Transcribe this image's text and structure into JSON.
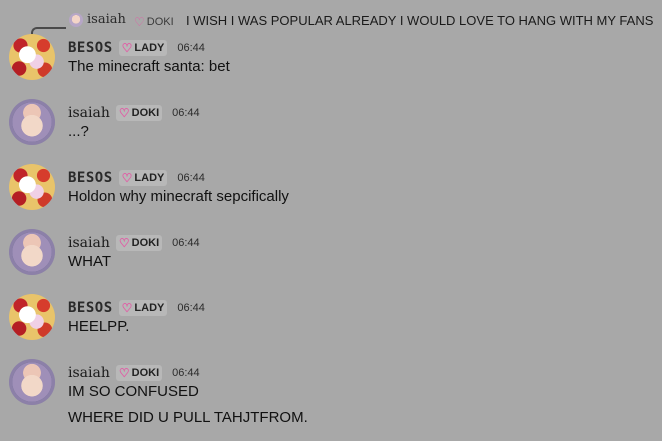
{
  "reply": {
    "name": "isaiah",
    "badge": "DOKI",
    "text": "I WISH I WAS POPULAR ALREADY I WOULD LOVE TO HANG WITH MY FANS"
  },
  "messages": [
    {
      "user": "BESOS",
      "badge": "LADY",
      "time": "06:44",
      "lines": [
        "The minecraft santa: bet"
      ]
    },
    {
      "user": "isaiah",
      "badge": "DOKI",
      "time": "06:44",
      "lines": [
        "...?"
      ]
    },
    {
      "user": "BESOS",
      "badge": "LADY",
      "time": "06:44",
      "lines": [
        "Holdon why minecraft sepcifically"
      ]
    },
    {
      "user": "isaiah",
      "badge": "DOKI",
      "time": "06:44",
      "lines": [
        "WHAT"
      ]
    },
    {
      "user": "BESOS",
      "badge": "LADY",
      "time": "06:44",
      "lines": [
        "HEELPP."
      ]
    },
    {
      "user": "isaiah",
      "badge": "DOKI",
      "time": "06:44",
      "lines": [
        "IM SO CONFUSED",
        "WHERE DID U PULL TAHJTFROM."
      ]
    }
  ]
}
